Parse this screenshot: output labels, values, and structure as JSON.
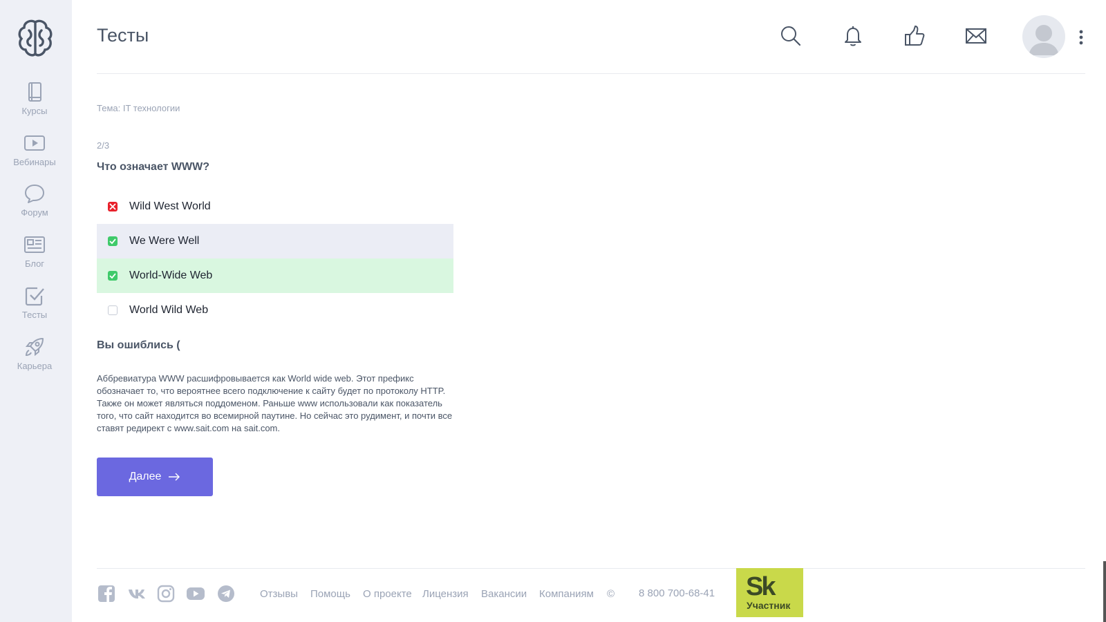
{
  "sidebar": {
    "logo_icon": "brain-logo-icon",
    "items": [
      {
        "label": "Курсы",
        "icon": "book-icon"
      },
      {
        "label": "Вебинары",
        "icon": "play-icon"
      },
      {
        "label": "Форум",
        "icon": "chat-bubble-icon"
      },
      {
        "label": "Блог",
        "icon": "newspaper-icon"
      },
      {
        "label": "Тесты",
        "icon": "checkbox-icon"
      },
      {
        "label": "Карьера",
        "icon": "rocket-icon"
      }
    ]
  },
  "header": {
    "title": "Тесты",
    "icons": [
      "search-icon",
      "bell-icon",
      "thumbs-up-icon",
      "mail-icon"
    ]
  },
  "quiz": {
    "theme": "Тема: IT технологии",
    "counter": "2/3",
    "question": "Что означает WWW?",
    "answers": [
      {
        "text": "Wild West World",
        "state": "wrong"
      },
      {
        "text": "We Were Well",
        "state": "checked"
      },
      {
        "text": "World-Wide Web",
        "state": "correct"
      },
      {
        "text": "World Wild Web",
        "state": "unchecked"
      }
    ],
    "result": "Вы ошиблись (",
    "explanation": "Аббревиатура WWW расшифровывается как World wide web. Этот префикс обозначает то, что вероятнее всего подключение к сайту будет по протоколу HTTP. Также он может являться поддоменом. Раньше www использовали как показатель того, что сайт находится во всемирной паутине. Но сейчас это рудимент, и почти все ставят редирект с www.sait.com на sait.com.",
    "next_label": "Далее"
  },
  "footer": {
    "social": [
      "facebook-icon",
      "vk-icon",
      "instagram-icon",
      "youtube-icon",
      "telegram-icon"
    ],
    "links": [
      "Отзывы",
      "Помощь",
      "О проекте",
      "Лицензия",
      "Вакансии",
      "Компаниям",
      "©"
    ],
    "phone": "8 800 700-68-41",
    "badge_logo": "Sk",
    "badge_text": "Участник"
  },
  "colors": {
    "accent": "#6b68e0",
    "wrong": "#e8212b",
    "right": "#3fca6a",
    "correct_bg": "#d9f7e0",
    "selected_bg": "#ebedf5",
    "sidebar_bg": "#eef0f6",
    "badge": "#c9d94a"
  }
}
